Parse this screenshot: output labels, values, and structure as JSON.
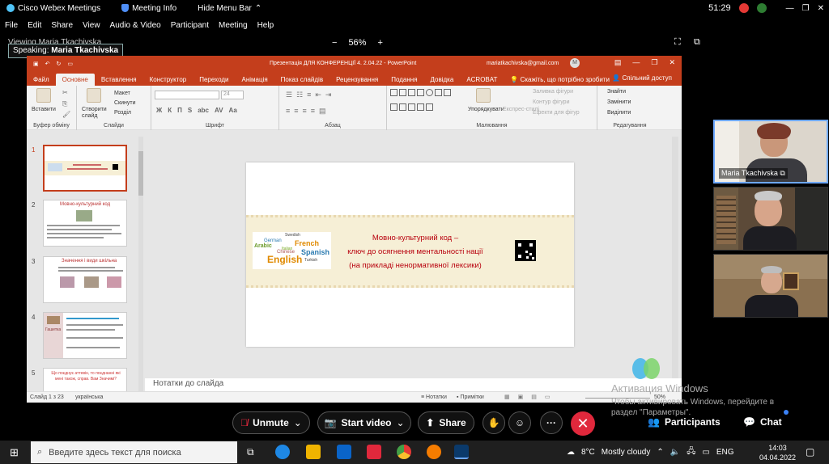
{
  "webex": {
    "app_name": "Cisco Webex Meetings",
    "meeting_info": "Meeting Info",
    "hide_menu_bar": "Hide Menu Bar",
    "timer": "51:29",
    "menu": [
      "File",
      "Edit",
      "Share",
      "View",
      "Audio & Video",
      "Participant",
      "Meeting",
      "Help"
    ],
    "viewing_label": "Viewing Maria Tkachivska",
    "zoom_minus": "−",
    "zoom_level": "56%",
    "zoom_plus": "+",
    "speaking_prefix": "Speaking:",
    "speaking_name": "Maria Tkachivska"
  },
  "ppt": {
    "window_title": "Презентація ДЛЯ КОНФЕРЕНЦІЇ 4.  2.04.22  -  PowerPoint",
    "user_email": "mariatkachivska@gmail.com",
    "avatar_initial": "M",
    "tabs": [
      "Файл",
      "Основне",
      "Вставлення",
      "Конструктор",
      "Переходи",
      "Анімація",
      "Показ слайдів",
      "Рецензування",
      "Подання",
      "Довідка",
      "ACROBAT",
      "Скажіть, що потрібно зробити"
    ],
    "active_tab": "Основне",
    "share_label": "Спільний доступ",
    "ribbon": {
      "insert": "Вставити",
      "clipboard": "Буфер обміну",
      "create_slide": "Створити слайд",
      "layout": "Макет",
      "reset": "Скинути",
      "section": "Розділ",
      "slides": "Слайди",
      "font": "Шрифт",
      "font_size": "24",
      "paragraph": "Абзац",
      "arrange": "Упорядкувати",
      "express_styles": "Експрес-стилі",
      "shape_fill": "Заливка фігури",
      "shape_outline": "Контур фігури",
      "shape_effects": "Ефекти для фігур",
      "drawing": "Малювання",
      "find": "Знайти",
      "replace": "Замінити",
      "select": "Виділити",
      "editing": "Редагування",
      "format_letters": [
        "Ж",
        "К",
        "П",
        "S",
        "abc",
        "AV",
        "Aa"
      ]
    },
    "slide_numbers": [
      "1",
      "2",
      "3",
      "4",
      "5"
    ],
    "thumb2_title": "Мовно-культурний код",
    "thumb3_title": "Значення і види шкільна",
    "thumb4_caption": "Гашетка",
    "thumb5_text": "Що поєднує аттевін, то поєднанні які мені також, справ. Вам Значимі?",
    "slide": {
      "title_line1": "Мовно-культурний код –",
      "title_line2": "ключ до осягнення ментальності нації",
      "title_line3": "(на прикладі ненормативної лексики)",
      "cloud_words": [
        "Swedish",
        "French",
        "Arabic",
        "German",
        "English",
        "Spanish",
        "Turkish",
        "Italian",
        "Chinese"
      ]
    },
    "notes_label": "Нотатки до слайда",
    "status": {
      "slide_counter": "Слайд 1 з 23",
      "language": "українська",
      "notes": "Нотатки",
      "comments": "Примітки",
      "zoom": "50%"
    }
  },
  "participants_tiles": [
    {
      "name": "Maria Tkachivska"
    },
    {
      "name": ""
    },
    {
      "name": ""
    }
  ],
  "activation": {
    "title": "Активация Windows",
    "line1": "Чтобы активировать Windows, перейдите в",
    "line2": "раздел \"Параметры\"."
  },
  "controls": {
    "unmute": "Unmute",
    "start_video": "Start video",
    "share": "Share",
    "participants": "Participants",
    "chat": "Chat",
    "more": "···"
  },
  "taskbar": {
    "search_placeholder": "Введите здесь текст для поиска",
    "temperature": "8°C",
    "weather": "Mostly cloudy",
    "lang": "ENG",
    "time": "14:03",
    "date": "04.04.2022"
  }
}
